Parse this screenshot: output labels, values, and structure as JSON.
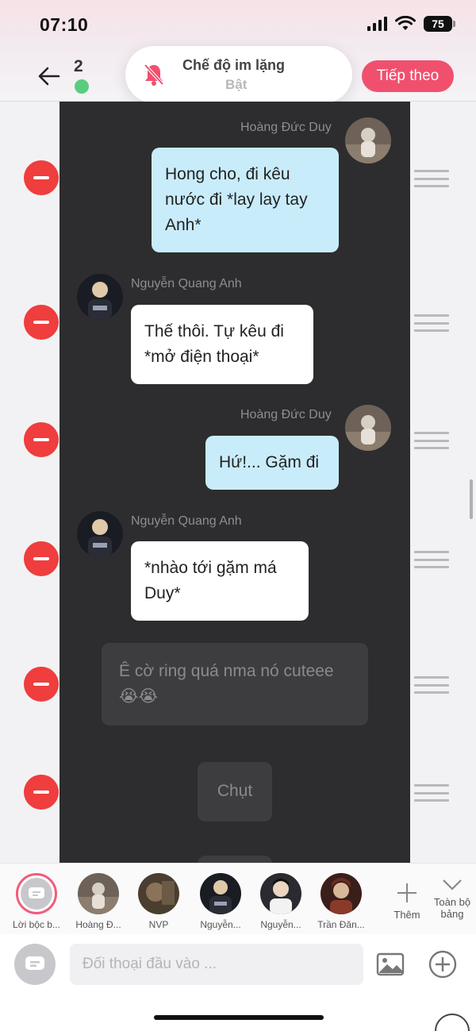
{
  "status_bar": {
    "time": "07:10",
    "battery": "75"
  },
  "header": {
    "count": "2",
    "silent_mode": {
      "title": "Chế độ im lặng",
      "state": "Bật"
    },
    "next_label": "Tiếp theo"
  },
  "messages": [
    {
      "sender": "Hoàng Đức Duy",
      "text": "Hong cho, đi kêu nước đi *lay lay tay Anh*",
      "side": "right"
    },
    {
      "sender": "Nguyễn Quang Anh",
      "text": "Thế thôi. Tự kêu đi *mở điện thoại*",
      "side": "left"
    },
    {
      "sender": "Hoàng Đức Duy",
      "text": "Hứ!... Gặm đi",
      "side": "right"
    },
    {
      "sender": "Nguyễn Quang Anh",
      "text": "*nhào tới gặm má Duy*",
      "side": "left"
    },
    {
      "sender": "",
      "text": "Ê cờ ring quá nma nó cuteee 😭😭",
      "side": "narration"
    },
    {
      "sender": "",
      "text": "Chụt",
      "side": "narration"
    }
  ],
  "characters": [
    {
      "label": "Lời bộc b..."
    },
    {
      "label": "Hoàng Đ..."
    },
    {
      "label": "NVP"
    },
    {
      "label": "Nguyễn..."
    },
    {
      "label": "Nguyễn..."
    },
    {
      "label": "Trần Đăn..."
    }
  ],
  "strip_actions": {
    "more_label": "Thêm",
    "all_label": "Toàn bộ bảng"
  },
  "input": {
    "placeholder": "Đối thoại đầu vào ..."
  },
  "colors": {
    "accent": "#f0506e",
    "delete": "#f03d3d",
    "chat_bg": "#2d2d2f",
    "bubble_blue": "#c9ecfb"
  }
}
